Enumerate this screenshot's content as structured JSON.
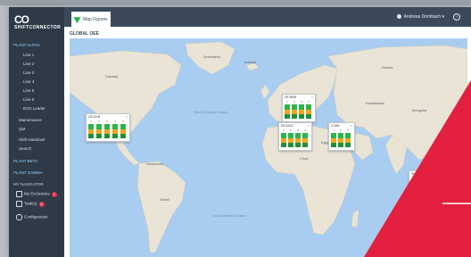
{
  "app": {
    "logo_text": "SHIFTCONNECTOR",
    "logo_mark": "CO"
  },
  "sidebar": {
    "section1": "PLANT ALPHA",
    "lines": [
      "Line 1",
      "Line 2",
      "Line 3",
      "Line 4",
      "Line 5",
      "Line 6",
      "ECD Leader"
    ],
    "items": [
      "Maintenance",
      "QM",
      "Shift Handover",
      "Search"
    ],
    "section2": "PLANT BETA",
    "section3": "PLANT GAMMA",
    "section4": "MY NAVIGATOR",
    "my_items": [
      {
        "label": "My Exclusions",
        "badge": "1"
      },
      {
        "label": "Task(s)",
        "badge": "5"
      }
    ],
    "configuration": "Configuration"
  },
  "topbar": {
    "tab_label": "Map Figures",
    "user_name": "Andreas Dombach",
    "help": "?"
  },
  "page": {
    "title": "GLOBAL OEE"
  },
  "map_labels": {
    "greenland": "Greenland",
    "iceland": "Iceland",
    "canada": "Canada",
    "russia": "Russia",
    "kazakhstan": "Kazakhstan",
    "mongolia": "Mongolia",
    "libya": "Libya",
    "egypt": "Egypt",
    "chad": "Chad",
    "brazil": "Brazil",
    "mexico": "Mexico",
    "venezuela": "Venezuela",
    "north_atlantic": "North Atlantic Ocean",
    "south_atlantic": "South Atlantic Ocean"
  },
  "plants": [
    {
      "name": "US-NYB",
      "cols": [
        "1",
        "2",
        "3",
        "4",
        "5"
      ]
    },
    {
      "name": "DE-BNR",
      "cols": [
        "1",
        "2",
        "3",
        "4"
      ]
    },
    {
      "name": "DE-MUC",
      "cols": [
        "1",
        "2",
        "3",
        "4"
      ]
    },
    {
      "name": "IT-MIL",
      "cols": [
        "1",
        "2",
        "3"
      ]
    },
    {
      "name": "IN-MBI",
      "cols": [
        "1",
        "2",
        "3"
      ]
    }
  ],
  "colors": {
    "sidebar": "#2e3a47",
    "topbar": "#3a4a5b",
    "ocean": "#a9cdf0",
    "land": "#e8e3d8",
    "status_good": "#2db34a",
    "status_warn": "#f5a623",
    "accent_red": "#e3203f"
  }
}
